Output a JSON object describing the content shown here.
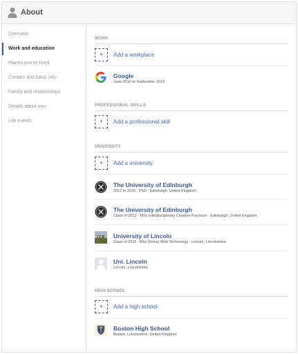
{
  "header": {
    "title": "About",
    "icon": "person-icon"
  },
  "sidebar": {
    "items": [
      {
        "label": "Overview"
      },
      {
        "label": "Work and education"
      },
      {
        "label": "Places you've lived"
      },
      {
        "label": "Contact and basic info"
      },
      {
        "label": "Family and relationships"
      },
      {
        "label": "Details about you"
      },
      {
        "label": "Life events"
      }
    ],
    "active": "Work and education"
  },
  "colors": {
    "link": "#365899",
    "accent": "#4267b2",
    "muted": "#90949c"
  },
  "work": {
    "title": "WORK",
    "add_label": "Add a workplace",
    "entries": [
      {
        "name": "Google",
        "detail": "June 2010 to September 2010",
        "icon": "google-logo"
      }
    ]
  },
  "skills": {
    "title": "PROFESSIONAL SKILLS",
    "add_label": "Add a professional skill"
  },
  "university": {
    "title": "UNIVERSITY",
    "add_label": "Add a university",
    "entries": [
      {
        "name": "The University of Edinburgh",
        "detail": "2012 to 2016 · PhD · Edinburgh, United Kingdom",
        "icon": "university-crest-icon"
      },
      {
        "name": "The University of Edinburgh",
        "detail": "Class of 2012 · MSc Interdisciplinary Creative Practices · Edinburgh, United Kingdom",
        "icon": "university-crest-icon"
      },
      {
        "name": "University of Lincoln",
        "detail": "Class of 2011 · BSc (Hons) Web Technology · Lincoln, Lincolnshire",
        "icon": "campus-photo"
      },
      {
        "name": "Uni. Lincoln",
        "detail": "Lincoln, Lincolnshire",
        "icon": "default-avatar"
      }
    ]
  },
  "high_school": {
    "title": "HIGH SCHOOL",
    "add_label": "Add a high school",
    "entries": [
      {
        "name": "Boston High School",
        "detail": "Boston, Lincolnshire, United Kingdom",
        "icon": "school-crest-icon"
      }
    ]
  }
}
